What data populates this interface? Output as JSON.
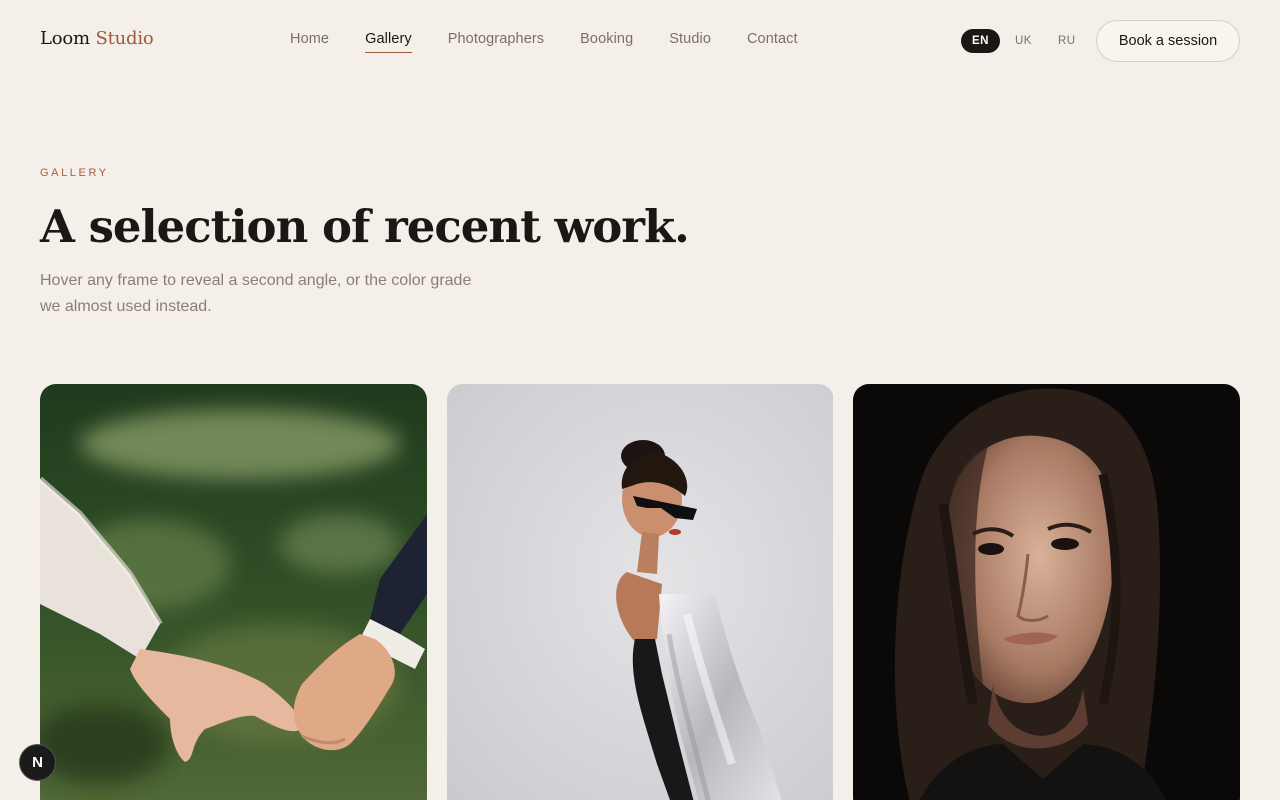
{
  "brand": {
    "name_part1": "Loom",
    "name_part2": "Studio"
  },
  "nav": {
    "items": [
      {
        "label": "Home"
      },
      {
        "label": "Gallery",
        "active": true
      },
      {
        "label": "Photographers"
      },
      {
        "label": "Booking"
      },
      {
        "label": "Studio"
      },
      {
        "label": "Contact"
      }
    ]
  },
  "languages": {
    "items": [
      {
        "label": "EN",
        "selected": true
      },
      {
        "label": "UK"
      },
      {
        "label": "RU"
      }
    ]
  },
  "cta": {
    "label": "Book a session"
  },
  "hero": {
    "eyebrow": "GALLERY",
    "title": "A selection of recent work.",
    "subtitle": "Hover any frame to reveal a second angle, or the color grade we almost used instead."
  },
  "gallery": {
    "items": [
      {
        "subject": "holding-hands-photo"
      },
      {
        "subject": "fashion-portrait-photo"
      },
      {
        "subject": "woman-portrait-photo"
      }
    ]
  },
  "dev_badge": {
    "label": "N"
  },
  "colors": {
    "background": "#f4efe8",
    "accent": "#9a5a3c",
    "text": "#1a1714",
    "muted": "#8a7f76"
  }
}
